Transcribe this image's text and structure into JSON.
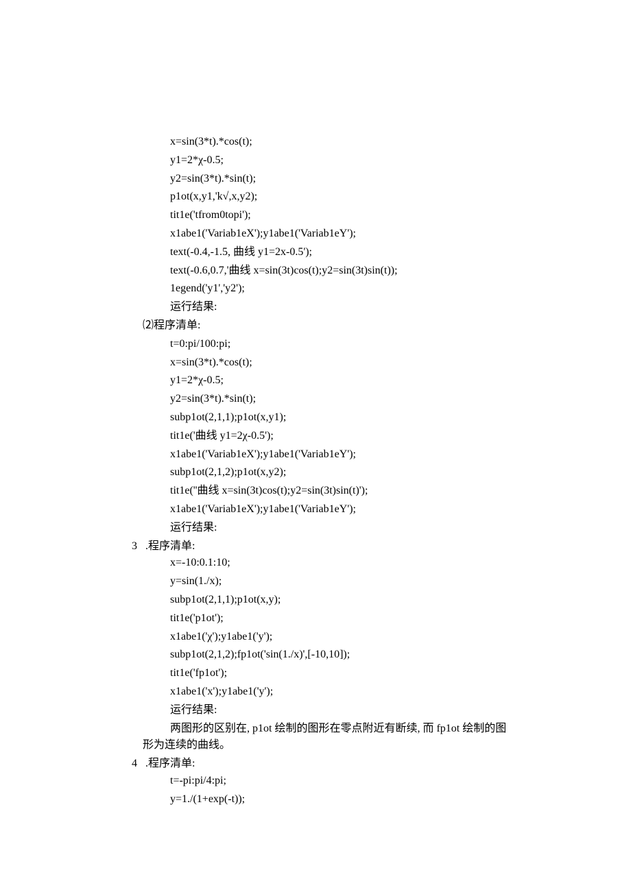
{
  "block1": {
    "lines": [
      "x=sin(3*t).*cos(t);",
      "y1=2*χ-0.5;",
      "y2=sin(3*t).*sin(t);",
      "p1ot(x,y1,'k√,x,y2);",
      "tit1e('tfrom0topi');",
      "x1abe1('Variab1eX');y1abe1('Variab1eY');",
      "text(-0.4,-1.5,   曲线 y1=2x-0.5');",
      "text(-0.6,0.7,'曲线 x=sin(3t)cos(t);y2=sin(3t)sin(t));",
      "1egend('y1','y2');"
    ],
    "result": "运行结果:"
  },
  "section2": {
    "head": "⑵程序清单:",
    "lines": [
      "t=0:pi/100:pi;",
      "x=sin(3*t).*cos(t);",
      "y1=2*χ-0.5;",
      "y2=sin(3*t).*sin(t);",
      "subp1ot(2,1,1);p1ot(x,y1);",
      "tit1e('曲线 y1=2χ-0.5');",
      "x1abe1('Variab1eX');y1abe1('Variab1eY');",
      "subp1ot(2,1,2);p1ot(x,y2);",
      "tit1e(''曲线 x=sin(3t)cos(t);y2=sin(3t)sin(t)');",
      "x1abe1('Variab1eX');y1abe1('Variab1eY');"
    ],
    "result": "运行结果:"
  },
  "section3": {
    "num": "3",
    "head": ".程序清单:",
    "lines": [
      "x=-10:0.1:10;",
      "y=sin(1./x);",
      "subp1ot(2,1,1);p1ot(x,y);",
      "tit1e('p1ot');",
      "x1abe1('χ');y1abe1('y');",
      "subp1ot(2,1,2);fp1ot('sin(1./x)',[-10,10]);",
      "tit1e('fp1ot');",
      "x1abe1('x');y1abe1('y');"
    ],
    "result": "运行结果:",
    "explain": "两图形的区别在, p1ot 绘制的图形在零点附近有断续, 而 fp1ot 绘制的图形为连续的曲线。"
  },
  "section4": {
    "num": "4",
    "head": ".程序清单:",
    "lines": [
      "t=-pi:pi/4:pi;",
      "y=1./(1+exp(-t));"
    ]
  }
}
